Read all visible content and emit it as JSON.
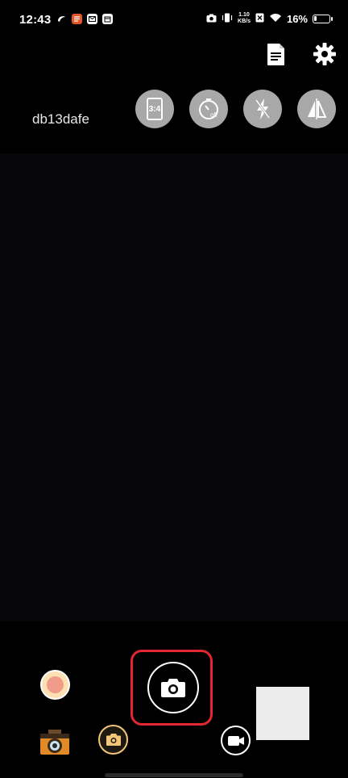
{
  "status_bar": {
    "time": "12:43",
    "left_icons": [
      "swirl-icon",
      "tasks-icon",
      "mail-icon",
      "calendar-icon"
    ],
    "right_icons": [
      "camera-icon",
      "vibrate-icon",
      "close-box-icon",
      "wifi-icon"
    ],
    "net_speed_value": "1.10",
    "net_speed_unit": "KB/s",
    "battery_percent": "16%",
    "battery_level": 0.16
  },
  "top_actions": {
    "document_icon": "document-icon",
    "settings_icon": "gear-icon"
  },
  "device_label": "db13dafe",
  "controls": {
    "aspect_ratio_label": "3:4",
    "timer_label": "off",
    "flash_icon": "flash-off-icon",
    "mirror_icon": "mirror-flip-icon"
  },
  "colors": {
    "highlight_border": "#e32630",
    "photo_mode_accent": "#f3c679",
    "control_chip_bg": "#a8a8a8",
    "gallery_dot_fill": "#f19c8a"
  }
}
